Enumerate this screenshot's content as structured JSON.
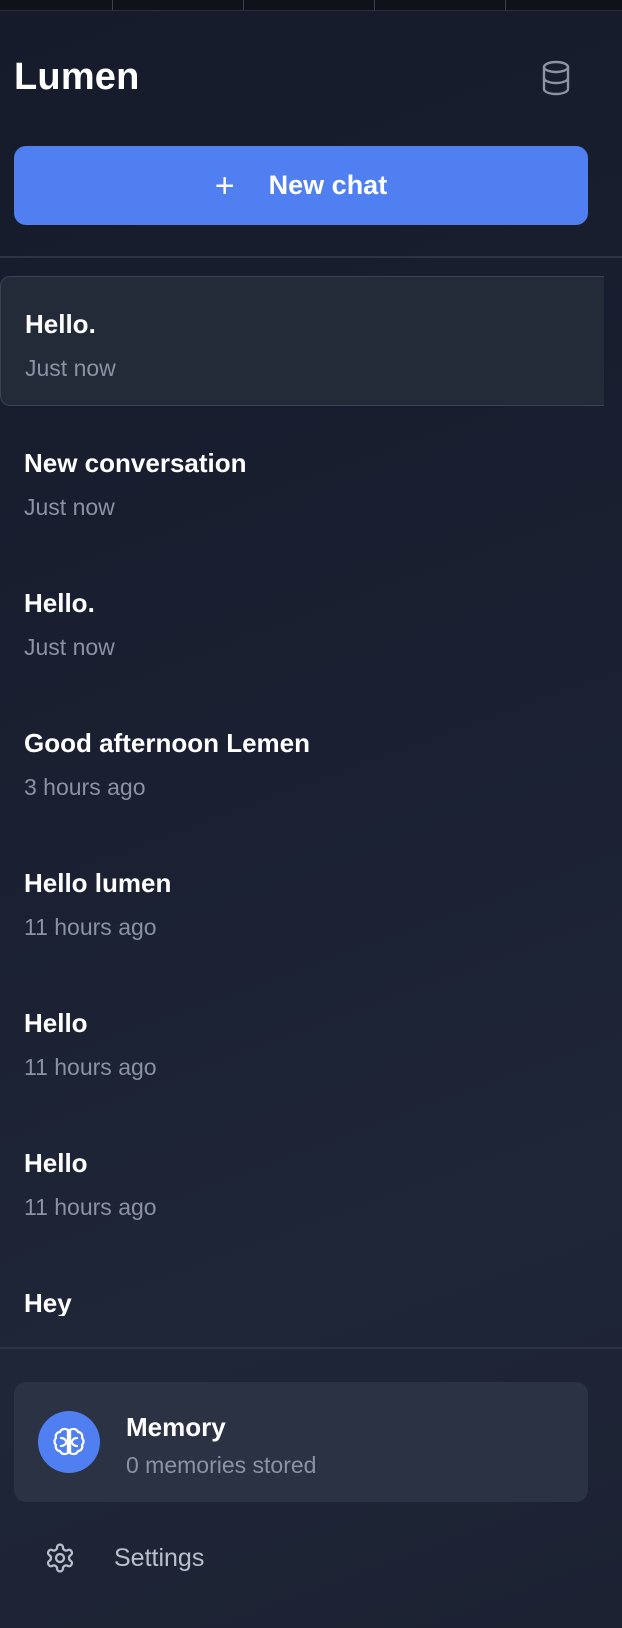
{
  "app": {
    "title": "Lumen"
  },
  "icons": {
    "database": "database-icon",
    "plus": "plus-icon",
    "brain": "brain-icon",
    "gear": "gear-icon"
  },
  "new_chat": {
    "plus_glyph": "+",
    "label": "New chat"
  },
  "chats": [
    {
      "title": "Hello.",
      "time": "Just now",
      "active": true
    },
    {
      "title": "New conversation",
      "time": "Just now",
      "active": false
    },
    {
      "title": "Hello.",
      "time": "Just now",
      "active": false
    },
    {
      "title": "Good afternoon Lemen",
      "time": "3 hours ago",
      "active": false
    },
    {
      "title": "Hello lumen",
      "time": "11 hours ago",
      "active": false
    },
    {
      "title": "Hello",
      "time": "11 hours ago",
      "active": false
    },
    {
      "title": "Hello",
      "time": "11 hours ago",
      "active": false
    },
    {
      "title": "Hey",
      "time": "",
      "active": false
    }
  ],
  "memory": {
    "title": "Memory",
    "subtitle": "0 memories stored"
  },
  "settings": {
    "label": "Settings"
  },
  "colors": {
    "accent": "#4f7ff0",
    "background": "#1a2031",
    "card": "#2a3244",
    "muted_text": "#8a92a3"
  }
}
